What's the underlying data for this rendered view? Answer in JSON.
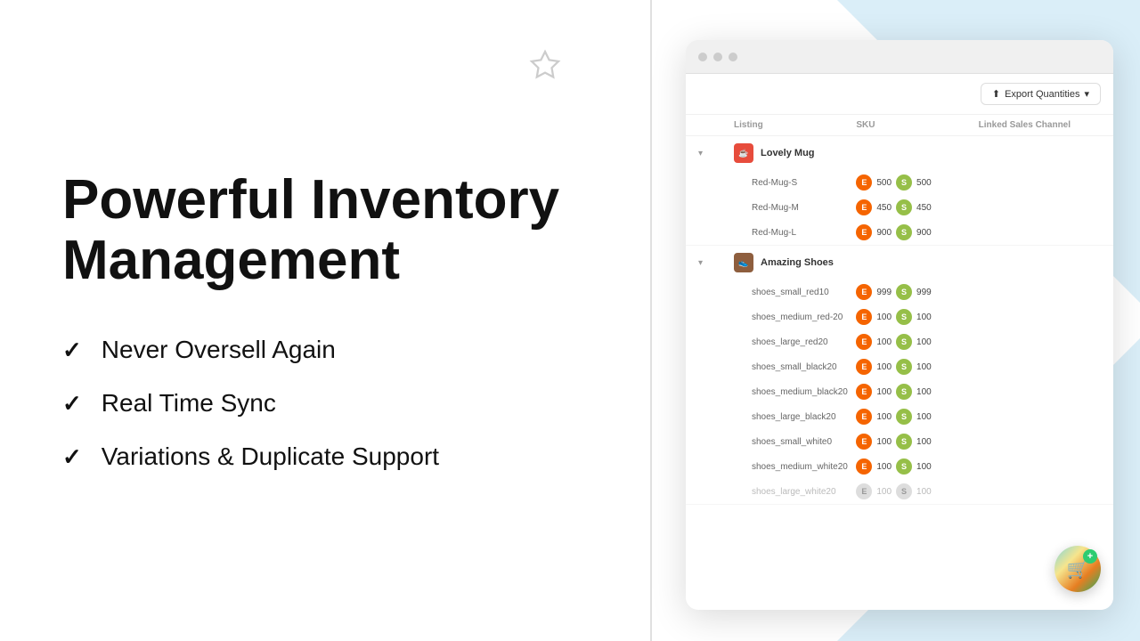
{
  "background": {
    "left_bg": "#ffffff",
    "right_bg": "#daeef8"
  },
  "left_panel": {
    "hero_title_line1": "Powerful Inventory",
    "hero_title_line2": "Management",
    "features": [
      {
        "id": "f1",
        "text": "Never Oversell Again"
      },
      {
        "id": "f2",
        "text": "Real Time Sync"
      },
      {
        "id": "f3",
        "text": "Variations & Duplicate Support"
      }
    ]
  },
  "browser": {
    "toolbar": {
      "export_button_label": "Export Quantities",
      "export_dropdown_arrow": "▾"
    },
    "table": {
      "columns": [
        "",
        "Listing",
        "SKU",
        "Linked Sales Channel"
      ],
      "products": [
        {
          "id": "p1",
          "name": "Lovely Mug",
          "thumb_color": "#e74c3c",
          "thumb_label": "☕",
          "variants": [
            {
              "sku": "Red-Mug-S",
              "etsy_qty": "500",
              "shopify_qty": "500",
              "faded": false
            },
            {
              "sku": "Red-Mug-M",
              "etsy_qty": "450",
              "shopify_qty": "450",
              "faded": false
            },
            {
              "sku": "Red-Mug-L",
              "etsy_qty": "900",
              "shopify_qty": "900",
              "faded": false
            }
          ]
        },
        {
          "id": "p2",
          "name": "Amazing Shoes",
          "thumb_color": "#8e5e3e",
          "thumb_label": "👟",
          "variants": [
            {
              "sku": "shoes_small_red10",
              "etsy_qty": "999",
              "shopify_qty": "999",
              "faded": false
            },
            {
              "sku": "shoes_medium_red-20",
              "etsy_qty": "100",
              "shopify_qty": "100",
              "faded": false
            },
            {
              "sku": "shoes_large_red20",
              "etsy_qty": "100",
              "shopify_qty": "100",
              "faded": false
            },
            {
              "sku": "shoes_small_black20",
              "etsy_qty": "100",
              "shopify_qty": "100",
              "faded": false
            },
            {
              "sku": "shoes_medium_black20",
              "etsy_qty": "100",
              "shopify_qty": "100",
              "faded": false
            },
            {
              "sku": "shoes_large_black20",
              "etsy_qty": "100",
              "shopify_qty": "100",
              "faded": false
            },
            {
              "sku": "shoes_small_white0",
              "etsy_qty": "100",
              "shopify_qty": "100",
              "faded": false
            },
            {
              "sku": "shoes_medium_white20",
              "etsy_qty": "100",
              "shopify_qty": "100",
              "faded": false
            },
            {
              "sku": "shoes_large_white20",
              "etsy_qty": "100",
              "shopify_qty": "100",
              "faded": true
            }
          ]
        }
      ]
    },
    "cart_fab": {
      "icon": "🛒",
      "plus": "+"
    }
  }
}
